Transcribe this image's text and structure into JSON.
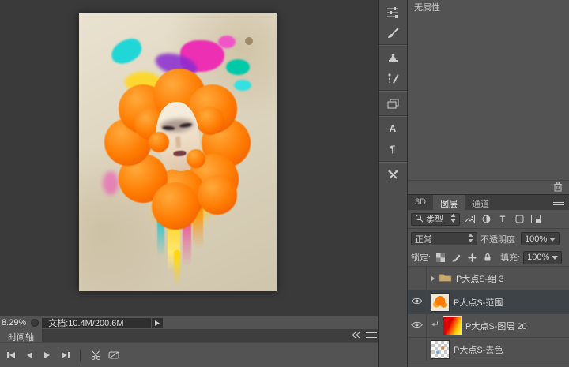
{
  "properties": {
    "title": "无属性"
  },
  "layers_panel": {
    "tabs": [
      "3D",
      "图层",
      "通道"
    ],
    "filter_type_label": "类型",
    "blend_mode": "正常",
    "opacity_label": "不透明度:",
    "opacity_value": "100%",
    "lock_label": "锁定:",
    "fill_label": "填充:",
    "fill_value": "100%",
    "layers": [
      {
        "name": "P大点S-组 3"
      },
      {
        "name": "P大点S-范围"
      },
      {
        "name": "P大点S-图层 20"
      },
      {
        "name": "P大点S-去色"
      }
    ]
  },
  "status_bar": {
    "zoom": "8.29%",
    "document_info": "文档:10.4M/200.6M"
  },
  "timeline_panel": {
    "tab_label": "时间轴"
  },
  "glyphs": {
    "type_filter": "T",
    "character_panel": "A",
    "paragraph_panel": "¶"
  },
  "colors": {
    "paint_orange": "#ff7a00",
    "paint_magenta": "#ed2fb4",
    "paint_cyan": "#21d6d6",
    "paint_yellow": "#ffd400"
  }
}
